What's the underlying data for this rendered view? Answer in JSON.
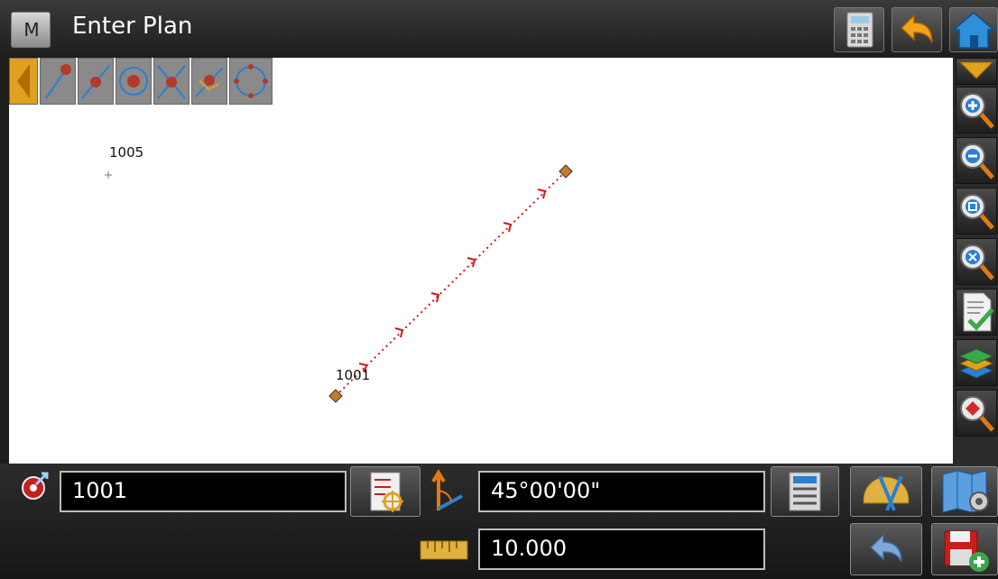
{
  "header": {
    "menu_label": "M",
    "title": "Enter Plan"
  },
  "header_icons": [
    "calculator-icon",
    "back-arrow-icon",
    "home-icon"
  ],
  "toolbar": {
    "icons": [
      "collapse-arrow-icon",
      "point-end-icon",
      "point-mid-icon",
      "point-center-icon",
      "point-intersection-icon",
      "point-perpendicular-icon",
      "point-quadrant-icon"
    ]
  },
  "right_toolbar": {
    "icons": [
      "dropdown-arrow-icon",
      "zoom-in-icon",
      "zoom-out-icon",
      "zoom-window-icon",
      "zoom-extents-icon",
      "checklist-icon",
      "layers-icon",
      "pan-icon"
    ]
  },
  "map": {
    "points": [
      {
        "label": "1005"
      },
      {
        "label": "1001"
      }
    ]
  },
  "form": {
    "from_point_value": "1001",
    "azimuth_value": "45°00'00\"",
    "distance_value": "10.000"
  },
  "bottom_icons": [
    "point-list-icon",
    "direction-icon",
    "calc-options-icon",
    "protractor-icon",
    "map-settings-icon",
    "ruler-icon",
    "undo-icon",
    "save-add-icon"
  ],
  "colors": {
    "accent": "#c98a00",
    "line": "#d01818",
    "background": "#1e1e1e"
  }
}
